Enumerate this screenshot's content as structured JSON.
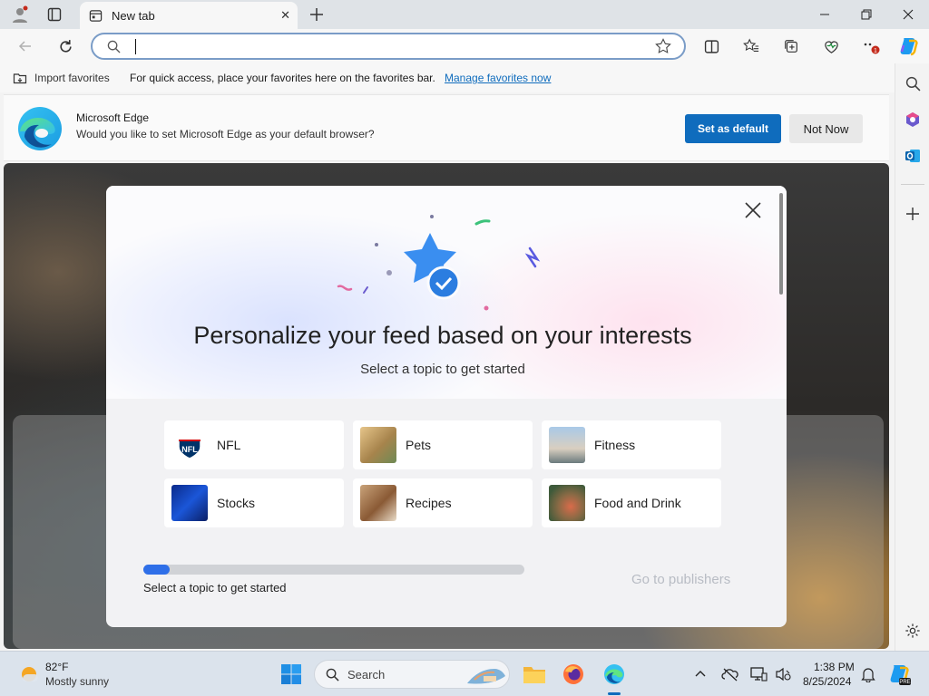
{
  "browser": {
    "tab": {
      "title": "New tab"
    },
    "address": {
      "value": "",
      "placeholder": ""
    }
  },
  "favorites_bar": {
    "import_label": "Import favorites",
    "message": "For quick access, place your favorites here on the favorites bar.",
    "manage_link": "Manage favorites now"
  },
  "default_banner": {
    "title": "Microsoft Edge",
    "text": "Would you like to set Microsoft Edge as your default browser?",
    "primary_button": "Set as default",
    "secondary_button": "Not Now"
  },
  "modal": {
    "title": "Personalize your feed based on your interests",
    "subtitle": "Select a topic to get started",
    "topics": [
      {
        "label": "NFL",
        "icon": "nfl-logo-icon"
      },
      {
        "label": "Pets",
        "icon": "pets-thumbnail"
      },
      {
        "label": "Fitness",
        "icon": "fitness-thumbnail"
      },
      {
        "label": "Stocks",
        "icon": "stocks-thumbnail"
      },
      {
        "label": "Recipes",
        "icon": "recipes-thumbnail"
      },
      {
        "label": "Food and Drink",
        "icon": "food-drink-thumbnail"
      }
    ],
    "progress_label": "Select a topic to get started",
    "progress_fraction": 0.07,
    "go_button": "Go to publishers"
  },
  "taskbar": {
    "weather": {
      "temp": "82°F",
      "condition": "Mostly sunny"
    },
    "search_label": "Search",
    "clock": {
      "time": "1:38 PM",
      "date": "8/25/2024"
    }
  },
  "colors": {
    "accent": "#0f6cbd",
    "progress": "#2f6fe8",
    "disabled_text": "#b8bcc4",
    "notification_badge": "#c42b1c"
  }
}
